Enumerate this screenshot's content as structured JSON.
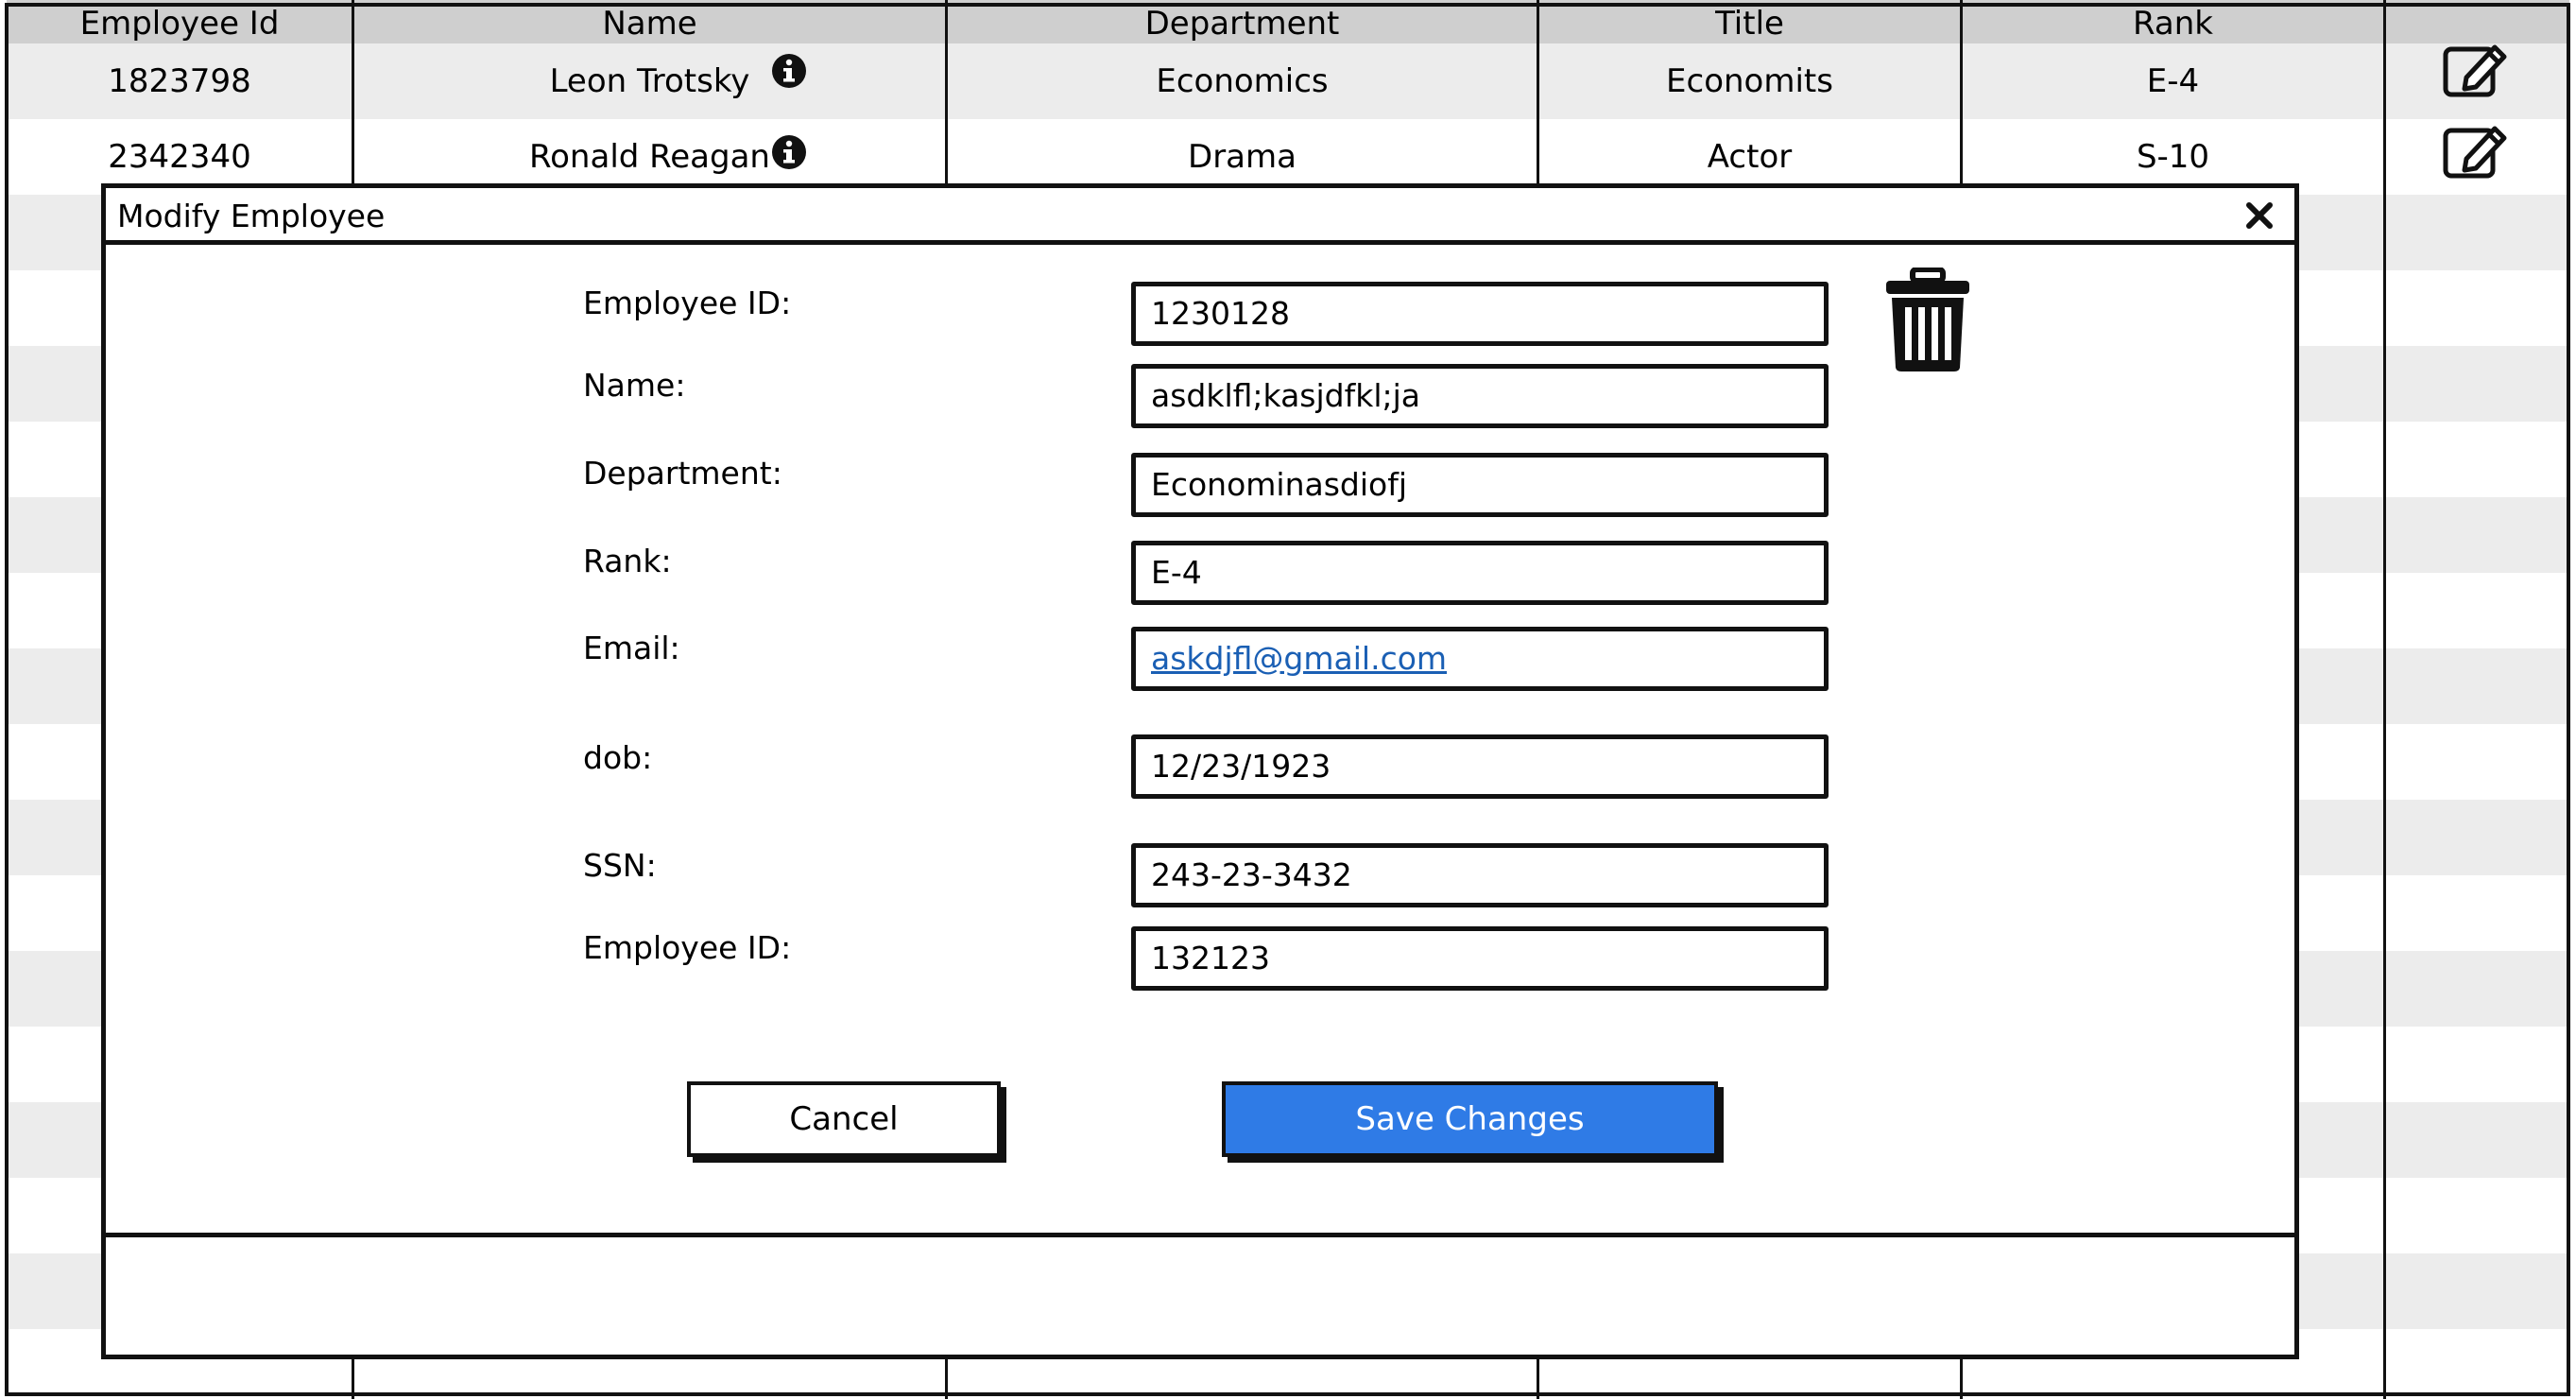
{
  "table": {
    "columns": [
      "Employee Id",
      "Name",
      "Department",
      "Title",
      "Rank"
    ],
    "rows": [
      {
        "employee_id": "1823798",
        "name": "Leon Trotsky",
        "department": "Economics",
        "title": "Economits",
        "rank": "E-4"
      },
      {
        "employee_id": "2342340",
        "name": "Ronald Reagan",
        "department": "Drama",
        "title": "Actor",
        "rank": "S-10"
      }
    ]
  },
  "modal": {
    "title": "Modify Employee",
    "fields": [
      {
        "label": "Employee ID:",
        "value": "1230128"
      },
      {
        "label": "Name:",
        "value": "asdklfl;kasjdfkl;ja"
      },
      {
        "label": "Department:",
        "value": "Econominasdiofj"
      },
      {
        "label": "Rank:",
        "value": "E-4"
      },
      {
        "label": "Email:",
        "value": "askdjfl@gmail.com"
      },
      {
        "label": "dob:",
        "value": "12/23/1923"
      },
      {
        "label": "SSN:",
        "value": "243-23-3432"
      },
      {
        "label": "Employee ID:",
        "value": "132123"
      }
    ],
    "cancel_label": "Cancel",
    "save_label": "Save Changes"
  },
  "icons": {
    "info": "info-icon",
    "edit": "edit-icon",
    "close": "close-icon",
    "delete": "trash-icon"
  },
  "colors": {
    "primary_button": "#2f7be6",
    "link": "#1a5fb4",
    "header_bg": "#cfcfcf",
    "stripe_bg": "#ececec"
  }
}
